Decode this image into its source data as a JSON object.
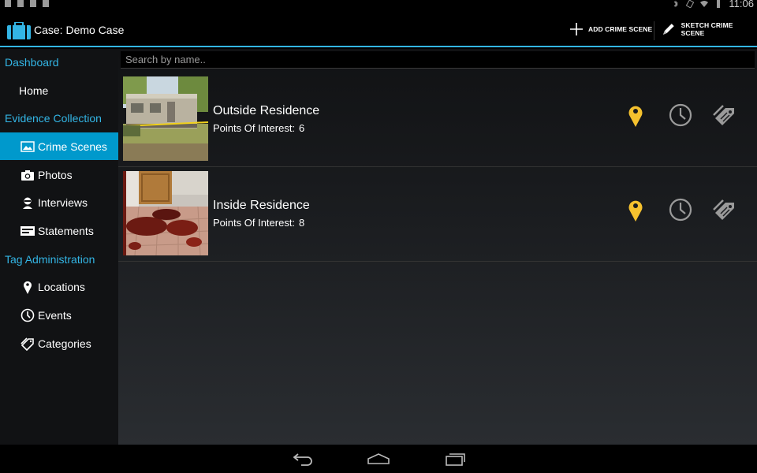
{
  "status_bar": {
    "time": "11:06"
  },
  "action_bar": {
    "title": "Case: Demo Case",
    "add_label": "ADD CRIME SCENE",
    "sketch_label": "SKETCH CRIME SCENE",
    "accent": "#33b5e5"
  },
  "sidebar": {
    "dashboard": "Dashboard",
    "home": "Home",
    "evidence_collection": "Evidence Collection",
    "crime_scenes": "Crime Scenes",
    "photos": "Photos",
    "interviews": "Interviews",
    "statements": "Statements",
    "tag_administration": "Tag Administration",
    "locations": "Locations",
    "events": "Events",
    "categories": "Categories",
    "active_color": "#0099cc"
  },
  "search": {
    "placeholder": "Search by name.."
  },
  "scenes": [
    {
      "name": "Outside Residence",
      "poi_label": "Points Of Interest:",
      "poi_count": "6"
    },
    {
      "name": "Inside Residence",
      "poi_label": "Points Of Interest:",
      "poi_count": "8"
    }
  ],
  "icons": {
    "location": "map-pin-icon",
    "events": "clock-icon",
    "tags": "tag-icon",
    "location_color": "#f5c12e"
  }
}
